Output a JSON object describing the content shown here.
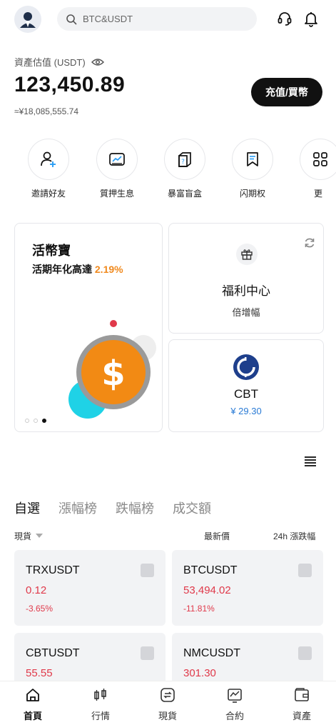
{
  "header": {
    "search_placeholder": "BTC&USDT"
  },
  "assets": {
    "label": "資產估值 (USDT)",
    "value": "123,450.89",
    "fiat": "≈¥18,085,555.74",
    "deposit_button": "充值/買幣"
  },
  "quick_actions": [
    {
      "label": "邀請好友",
      "icon": "add-user-icon"
    },
    {
      "label": "質押生息",
      "icon": "chart-card-icon"
    },
    {
      "label": "暴富盲盒",
      "icon": "mystery-box-icon"
    },
    {
      "label": "闪期权",
      "icon": "option-flag-icon"
    },
    {
      "label": "更",
      "icon": "more-icon"
    }
  ],
  "earn_card": {
    "title": "活幣寶",
    "subtitle": "活期年化高達",
    "rate": "2.19%"
  },
  "welfare_card": {
    "title": "福利中心",
    "subtitle": "倍增幅"
  },
  "cbt_card": {
    "title": "CBT",
    "price": "¥ 29.30"
  },
  "market_tabs": [
    "自選",
    "漲幅榜",
    "跌幅榜",
    "成交額"
  ],
  "market_active_tab": 0,
  "columns": {
    "spot": "現貨",
    "latest": "最新價",
    "change": "24h 漲跌幅"
  },
  "pairs": [
    {
      "name": "TRXUSDT",
      "price": "0.12",
      "change": "-3.65%"
    },
    {
      "name": "BTCUSDT",
      "price": "53,494.02",
      "change": "-11.81%"
    },
    {
      "name": "CBTUSDT",
      "price": "55.55",
      "change": ""
    },
    {
      "name": "NMCUSDT",
      "price": "301.30",
      "change": ""
    }
  ],
  "bottom_nav": [
    {
      "label": "首頁",
      "icon": "home-icon"
    },
    {
      "label": "行情",
      "icon": "candlestick-icon"
    },
    {
      "label": "現貨",
      "icon": "spot-exchange-icon"
    },
    {
      "label": "合約",
      "icon": "contract-chart-icon"
    },
    {
      "label": "資產",
      "icon": "wallet-icon"
    }
  ],
  "colors": {
    "accent_orange": "#f0891d",
    "negative_red": "#e0394a",
    "price_blue": "#2a7bd5",
    "primary_dark": "#111111"
  }
}
